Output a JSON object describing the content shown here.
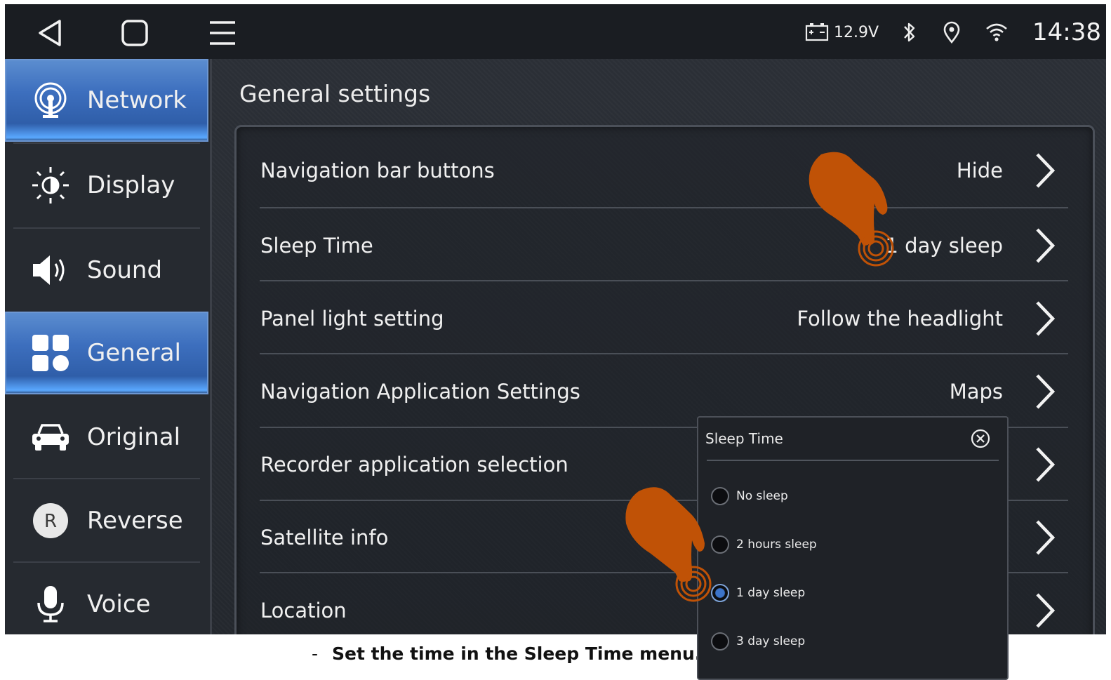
{
  "status_bar": {
    "nav_buttons": [
      "back-icon",
      "home-icon",
      "menu-icon"
    ],
    "battery_voltage": "12.9V",
    "icons": [
      "battery-icon",
      "bluetooth-icon",
      "location-pin-icon",
      "wifi-icon"
    ],
    "clock": "14:38"
  },
  "sidebar": {
    "items": [
      {
        "label": "Network",
        "icon": "network-antenna-icon",
        "active": true
      },
      {
        "label": "Display",
        "icon": "brightness-icon",
        "active": false
      },
      {
        "label": "Sound",
        "icon": "speaker-icon",
        "active": false
      },
      {
        "label": "General",
        "icon": "apps-grid-icon",
        "active": true
      },
      {
        "label": "Original",
        "icon": "car-icon",
        "active": false
      },
      {
        "label": "Reverse",
        "icon": "reverse-r-icon",
        "active": false
      },
      {
        "label": "Voice",
        "icon": "microphone-icon",
        "active": false
      }
    ]
  },
  "main": {
    "title": "General settings",
    "rows": [
      {
        "label": "Navigation bar buttons",
        "value": "Hide"
      },
      {
        "label": "Sleep Time",
        "value": "1 day sleep"
      },
      {
        "label": "Panel light setting",
        "value": "Follow the headlight"
      },
      {
        "label": "Navigation Application Settings",
        "value": "Maps"
      },
      {
        "label": "Recorder application selection",
        "value": ""
      },
      {
        "label": "Satellite info",
        "value": ""
      },
      {
        "label": "Location",
        "value": ""
      }
    ]
  },
  "popup": {
    "title": "Sleep Time",
    "options": [
      "No sleep",
      "2 hours sleep",
      "1 day sleep",
      "3 day sleep"
    ],
    "selected": "1 day sleep"
  },
  "caption": {
    "dash": "-",
    "text": "Set the time in the Sleep Time menu."
  },
  "colors": {
    "accent": "#3d6fbe",
    "hand": "#c05206",
    "background": "#272b31"
  }
}
